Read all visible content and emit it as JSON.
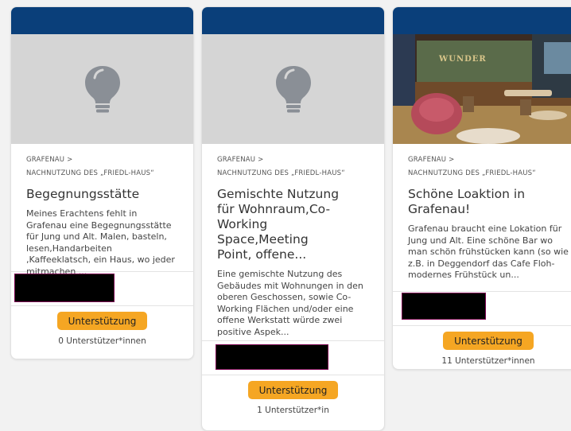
{
  "cards": [
    {
      "breadcrumb_1": "GRAFENAU >",
      "breadcrumb_2": "NACHNUTZUNG DES „FRIEDL-HAUS“",
      "title": "Begegnungsstätte",
      "excerpt": "Meines Erachtens fehlt in Grafenau eine Begegnungsstätte für Jung und Alt. Malen, basteln, lesen,Handarbeiten ,Kaffeeklatsch, ein Haus, wo jeder mitmachen ...",
      "button_label": "Unterstützung",
      "supporters": "0 Unterstützer*innen",
      "media": "lightbulb-icon"
    },
    {
      "breadcrumb_1": "GRAFENAU >",
      "breadcrumb_2": "NACHNUTZUNG DES „FRIEDL-HAUS“",
      "title": "Gemischte Nutzung für Wohnraum,Co-Working Space,Meeting Point, offene...",
      "excerpt": "Eine gemischte Nutzung des Gebäudes mit Wohnungen in den oberen Geschossen, sowie Co-Working Flächen und/oder eine offene Werkstatt würde zwei positive Aspek...",
      "button_label": "Unterstützung",
      "supporters": "1 Unterstützer*in",
      "media": "lightbulb-icon"
    },
    {
      "breadcrumb_1": "GRAFENAU >",
      "breadcrumb_2": "NACHNUTZUNG DES „FRIEDL-HAUS“",
      "title": "Schöne Loaktion in Grafenau!",
      "excerpt": "Grafenau braucht eine Lokation für Jung und Alt. Eine schöne Bar wo man schön frühstücken kann (so wie z.B. in Deggendorf das Cafe Floh- modernes Frühstück un...",
      "button_label": "Unterstützung",
      "supporters": "11 Unterstützer*innen",
      "media": "cafe-photo",
      "photo_sign": "WUNDER"
    }
  ],
  "colors": {
    "header_bar": "#0a3f7a",
    "button": "#f5a623",
    "placeholder_bg": "#d5d5d5",
    "icon": "#8a8f96"
  }
}
